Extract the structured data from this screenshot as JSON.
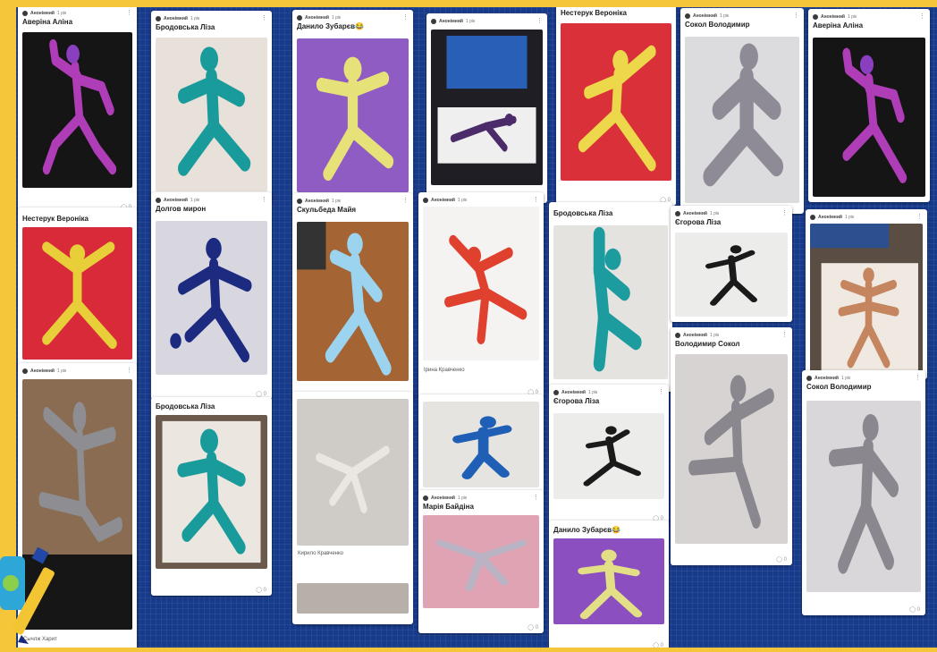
{
  "board": {
    "background": "#173a8a",
    "frame": "#f5c63a"
  },
  "post_meta": {
    "author": "Анонімний",
    "time": "1 рік"
  },
  "cards": [
    {
      "title": "Аверіна Аліна"
    },
    {
      "title": "Нестерук Вероніка"
    },
    {
      "caption": "Сычлж Харит"
    },
    {
      "title": "Бродовська Ліза"
    },
    {
      "title": "Долгов мирон"
    },
    {
      "title": "Бродовська Ліза"
    },
    {
      "title": "Данило Зубарєв😂"
    },
    {
      "title": "Скульбеда Майя"
    },
    {
      "caption": "Кирило Кравченко"
    },
    {
      "caption": "Ірина Кравченко"
    },
    {
      "title": "Марія Байдіна"
    },
    {
      "title": "Нестерук Вероніка"
    },
    {
      "title": "Бродовська Ліза"
    },
    {
      "title": "Єгорова Ліза"
    },
    {
      "title": "Данило Зубарєв😂"
    },
    {
      "title": "Сокол Володимир"
    },
    {
      "title": "Єгорова Ліза"
    },
    {
      "title": "Володимир Сокол"
    },
    {
      "title": "Аверіна Аліна"
    },
    {
      "title": "Сокол Володимир"
    }
  ]
}
